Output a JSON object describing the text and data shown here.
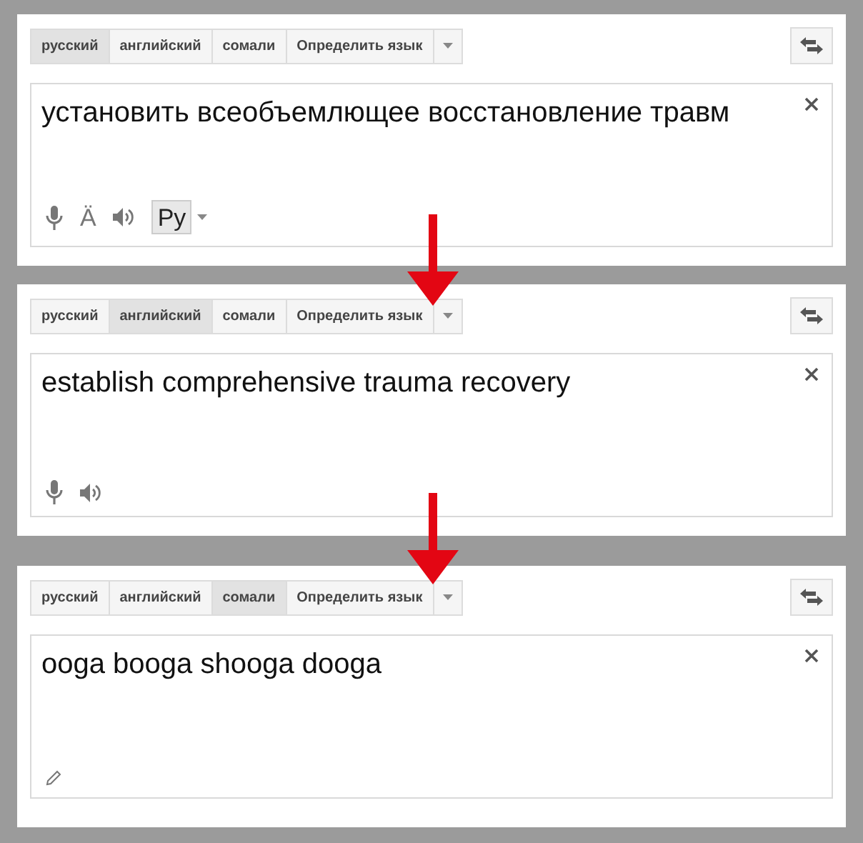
{
  "panels": [
    {
      "tabs": [
        {
          "label": "русский",
          "selected": true
        },
        {
          "label": "английский",
          "selected": false
        },
        {
          "label": "сомали",
          "selected": false
        },
        {
          "label": "Определить язык",
          "selected": false
        }
      ],
      "text": "установить всеобъемлющее восстановление травм",
      "tools": [
        {
          "kind": "mic"
        },
        {
          "kind": "char",
          "label": "Ä"
        },
        {
          "kind": "speaker"
        },
        {
          "kind": "keyboard",
          "label": "Ру"
        }
      ]
    },
    {
      "tabs": [
        {
          "label": "русский",
          "selected": false
        },
        {
          "label": "английский",
          "selected": true
        },
        {
          "label": "сомали",
          "selected": false
        },
        {
          "label": "Определить язык",
          "selected": false
        }
      ],
      "text": "establish comprehensive trauma recovery",
      "tools": [
        {
          "kind": "mic"
        },
        {
          "kind": "speaker"
        }
      ]
    },
    {
      "tabs": [
        {
          "label": "русский",
          "selected": false
        },
        {
          "label": "английский",
          "selected": false
        },
        {
          "label": "сомали",
          "selected": true
        },
        {
          "label": "Определить язык",
          "selected": false
        }
      ],
      "text": "ooga booga shooga dooga",
      "tools": [
        {
          "kind": "pencil"
        }
      ]
    }
  ]
}
